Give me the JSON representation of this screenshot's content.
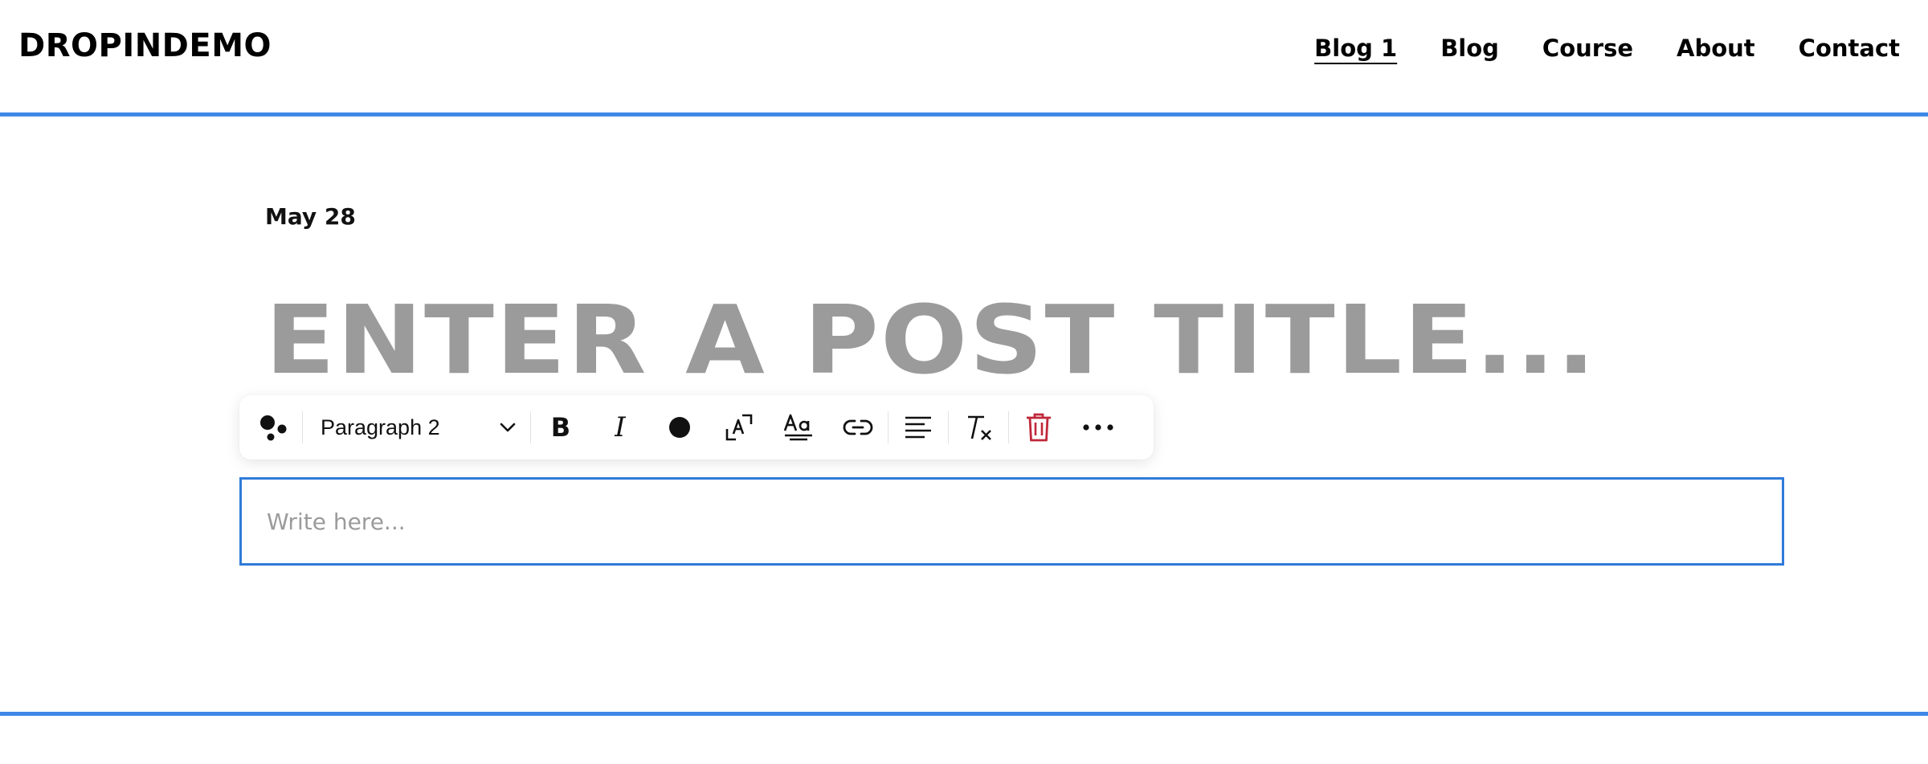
{
  "header": {
    "logo": "DROPINDEMO",
    "nav": [
      {
        "label": "Blog 1",
        "active": true
      },
      {
        "label": "Blog",
        "active": false
      },
      {
        "label": "Course",
        "active": false
      },
      {
        "label": "About",
        "active": false
      },
      {
        "label": "Contact",
        "active": false
      }
    ]
  },
  "post": {
    "date": "May 28",
    "title_placeholder": "ENTER A POST TITLE..."
  },
  "toolbar": {
    "text_style": "Paragraph 2",
    "bold_glyph": "B",
    "italic_glyph": "I",
    "icons": [
      "dots-icon",
      "chevron-down-icon",
      "bold-icon",
      "italic-icon",
      "text-color-icon",
      "font-size-icon",
      "text-case-icon",
      "link-icon",
      "align-left-icon",
      "clear-format-icon",
      "trash-icon",
      "more-icon"
    ]
  },
  "editor": {
    "placeholder": "Write here...",
    "value": ""
  },
  "colors": {
    "accent_line": "#3e88e6",
    "editor_border": "#2f7bd9",
    "title_placeholder": "#9b9b9b",
    "delete_icon": "#c0283a"
  }
}
